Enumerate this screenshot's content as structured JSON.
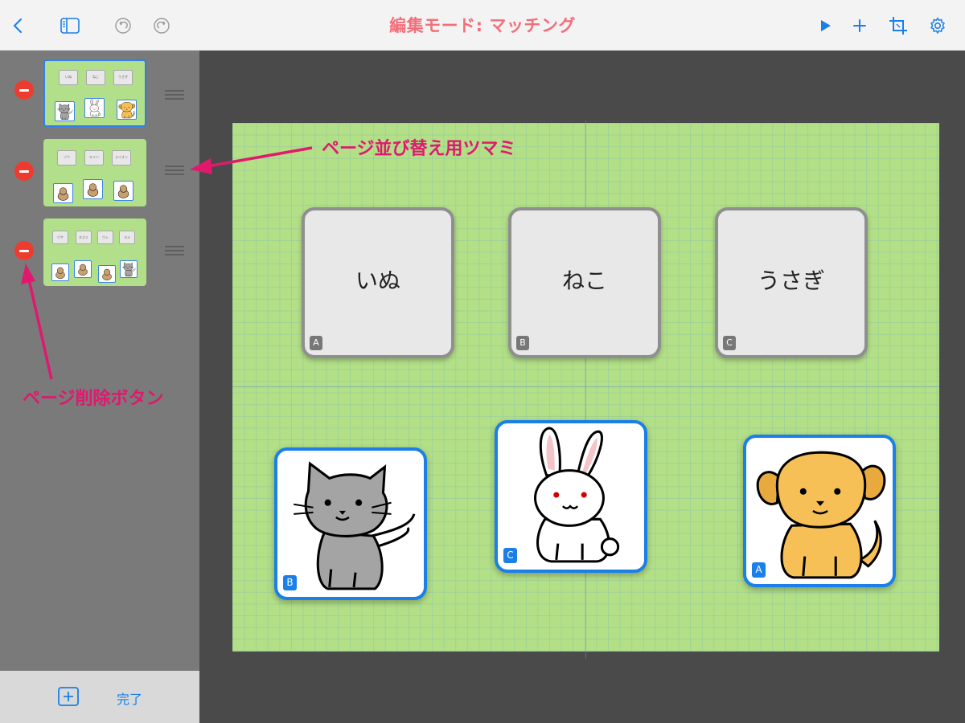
{
  "toolbar": {
    "title": "編集モード: マッチング",
    "accent_color": "#1a7fe8",
    "title_color": "#f26f7a",
    "left_icons": [
      "chevron-left-icon",
      "sidebar-icon",
      "undo-icon",
      "redo-icon"
    ],
    "right_icons": [
      "play-icon",
      "plus-icon",
      "crop-icon",
      "gear-icon"
    ]
  },
  "sidebar": {
    "pages": [
      {
        "selected": true,
        "words": [
          "いぬ",
          "ねこ",
          "うさぎ"
        ],
        "pictures": [
          "cat",
          "rabbit",
          "dog"
        ]
      },
      {
        "selected": false,
        "words": [
          "ゾウ",
          "キリン",
          "ライオン"
        ],
        "pictures": [
          "lion",
          "elephant",
          "giraffe"
        ]
      },
      {
        "selected": false,
        "words": [
          "ウサ",
          "ネズミ",
          "ウシ",
          "ヨメ"
        ],
        "pictures": [
          "hippo",
          "horse",
          "cow",
          "cat"
        ]
      }
    ],
    "done_label": "完了"
  },
  "canvas": {
    "word_cards": [
      {
        "text": "いぬ",
        "tag": "A"
      },
      {
        "text": "ねこ",
        "tag": "B"
      },
      {
        "text": "うさぎ",
        "tag": "C"
      }
    ],
    "picture_cards": [
      {
        "animal": "cat",
        "tag": "B"
      },
      {
        "animal": "rabbit",
        "tag": "C"
      },
      {
        "animal": "dog",
        "tag": "A"
      }
    ]
  },
  "annotations": {
    "handle_label": "ページ並び替え用ツマミ",
    "delete_label": "ページ削除ボタン",
    "color": "#e0196e"
  }
}
